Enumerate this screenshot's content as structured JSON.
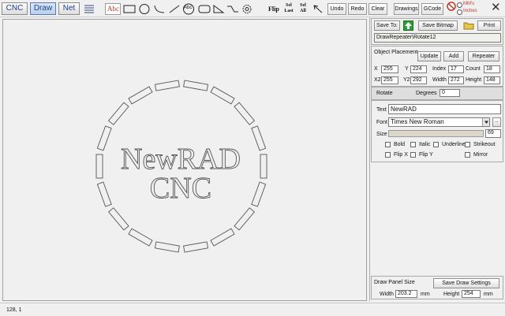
{
  "tabs": [
    {
      "label": "CNC"
    },
    {
      "label": "Draw"
    },
    {
      "label": "Net"
    }
  ],
  "toolbar": {
    "text_tool": "Abc",
    "circle_text_tool": "Abc",
    "flip_label": "Flip",
    "sel_last_top": "Sel",
    "sel_last_bottom": "Last",
    "sel_all_top": "Sel",
    "sel_all_bottom": "All",
    "undo": "Undo",
    "redo": "Redo",
    "clear": "Clear",
    "drawings": "Drawings",
    "gcode": "GCode",
    "unit_mms": "MM's",
    "unit_inches": "Inches",
    "close": "✕"
  },
  "canvas": {
    "text_line1": "NewRAD",
    "text_line2": "CNC"
  },
  "panel": {
    "save_to": "Save To:",
    "save_bitmap": "Save Bitmap",
    "print": "Print",
    "path": "DrawRepeater\\Rotate12",
    "placement_title": "Object Placement",
    "update": "Update",
    "add": "Add",
    "repeater": "Repeater",
    "x_label": "X",
    "x_value": "255",
    "y_label": "Y",
    "y_value": "224",
    "index_label": "Index",
    "index_value": "17",
    "count_label": "Count",
    "count_value": "18",
    "x2_label": "X2",
    "x2_value": "255",
    "y2_label": "Y2",
    "y2_value": "292",
    "width_label": "Width",
    "width_value": "272",
    "height_label": "Height",
    "height_value": "148",
    "rotate_label": "Rotate",
    "degrees_label": "Degrees",
    "degrees_value": "0",
    "text_label": "Text",
    "text_value": "NewRAD",
    "font_label": "Font",
    "font_value": "Times New Roman",
    "font_more": "..",
    "size_label": "Size",
    "size_value": "69",
    "bold": "Bold",
    "italic": "Italic",
    "underline": "Underline",
    "strikeout": "Strikeout",
    "flip_x": "Flip X",
    "flip_y": "Flip Y",
    "mirror": "Mirror",
    "draw_size_title": "Draw Panel Size",
    "save_draw_settings": "Save Draw Settings",
    "dp_width_label": "Width",
    "dp_width_value": "203.2",
    "dp_width_unit": "mm",
    "dp_height_label": "Height",
    "dp_height_value": "254",
    "dp_height_unit": "mm"
  },
  "status": {
    "coords": "128, 1"
  }
}
